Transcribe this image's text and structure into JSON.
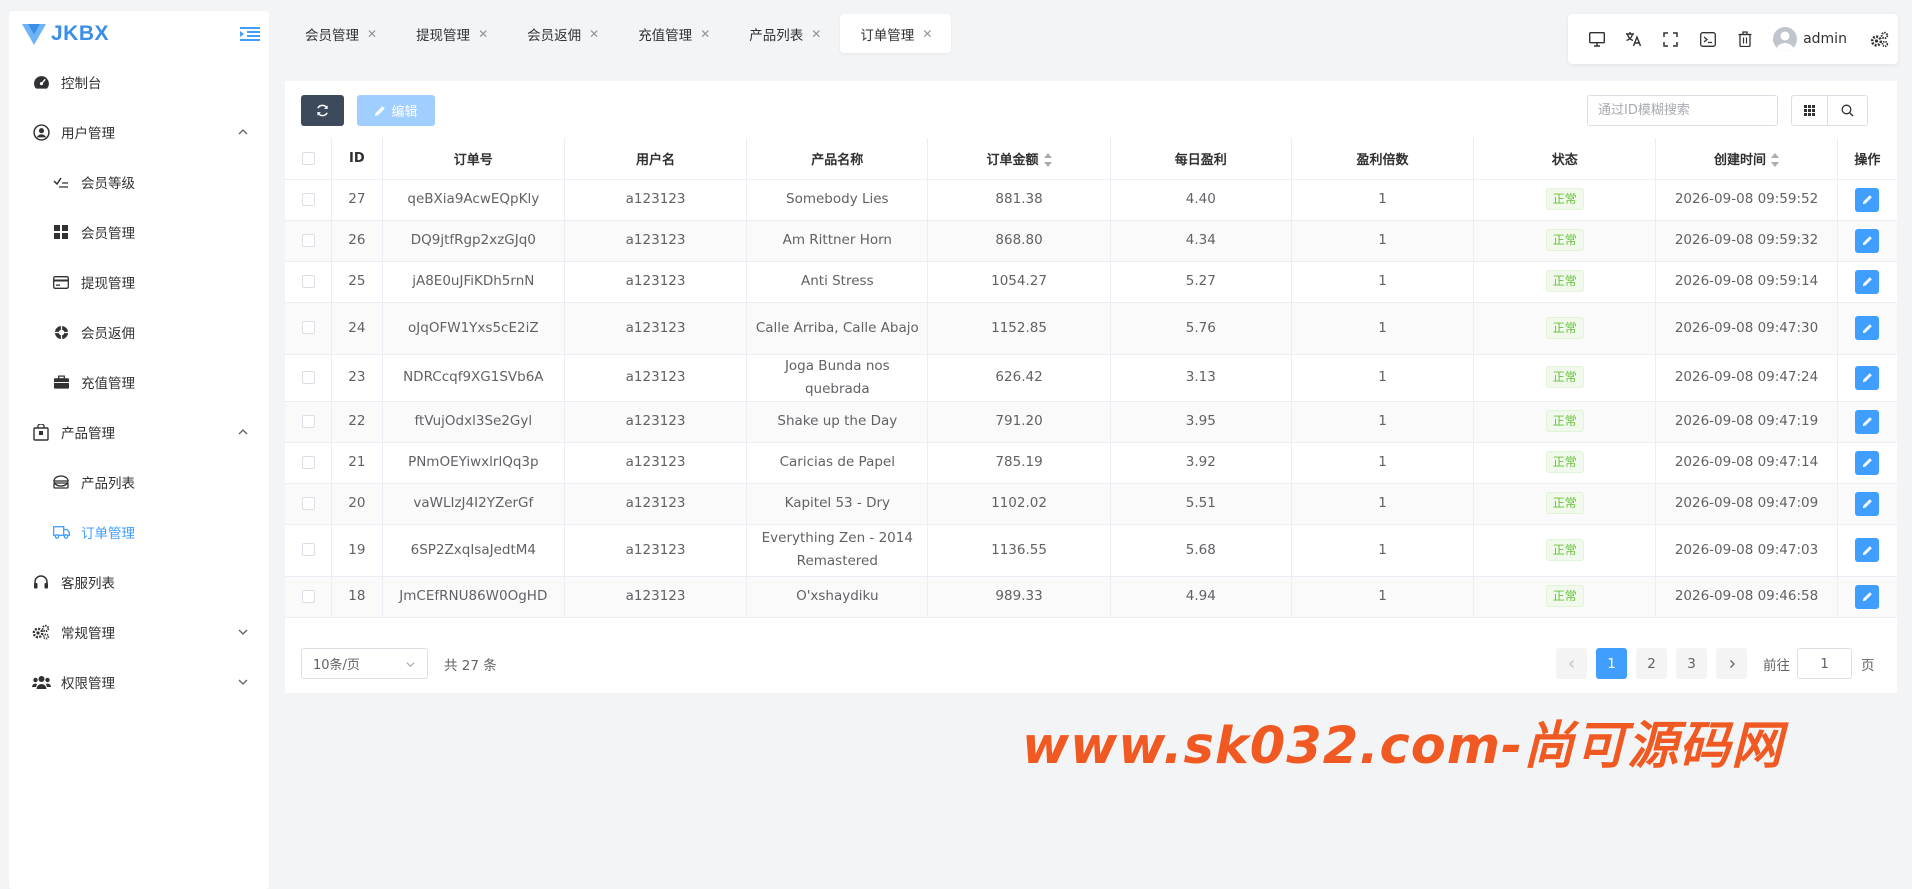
{
  "brand": {
    "name": "JKBX",
    "color": "#3a8ee6"
  },
  "sidebar": {
    "items": [
      {
        "label": "控制台",
        "icon": "dashboard-icon"
      },
      {
        "label": "用户管理",
        "icon": "user-circle-icon",
        "expanded": true,
        "children": [
          {
            "label": "会员等级",
            "icon": "level-icon"
          },
          {
            "label": "会员管理",
            "icon": "grid-icon"
          },
          {
            "label": "提现管理",
            "icon": "card-icon"
          },
          {
            "label": "会员返佣",
            "icon": "commission-icon"
          },
          {
            "label": "充值管理",
            "icon": "briefcase-icon"
          }
        ]
      },
      {
        "label": "产品管理",
        "icon": "product-icon",
        "expanded": true,
        "children": [
          {
            "label": "产品列表",
            "icon": "list-icon"
          },
          {
            "label": "订单管理",
            "icon": "truck-icon",
            "active": true
          }
        ]
      },
      {
        "label": "客服列表",
        "icon": "headset-icon"
      },
      {
        "label": "常规管理",
        "icon": "gears-icon",
        "expanded": false
      },
      {
        "label": "权限管理",
        "icon": "users-icon",
        "expanded": false
      }
    ]
  },
  "tabs": [
    {
      "label": "会员管理"
    },
    {
      "label": "提现管理"
    },
    {
      "label": "会员返佣"
    },
    {
      "label": "充值管理"
    },
    {
      "label": "产品列表"
    },
    {
      "label": "订单管理",
      "active": true
    }
  ],
  "toolbar": {
    "icons": [
      "monitor-icon",
      "translate-icon",
      "fullscreen-icon",
      "terminal-icon",
      "trash-icon"
    ],
    "user_name": "admin"
  },
  "actions": {
    "edit_label": "编辑",
    "search_placeholder": "通过ID模糊搜索"
  },
  "table": {
    "columns": [
      "ID",
      "订单号",
      "用户名",
      "产品名称",
      "订单金额",
      "每日盈利",
      "盈利倍数",
      "状态",
      "创建时间",
      "操作"
    ],
    "sortable": [
      "订单金额",
      "创建时间"
    ],
    "rows": [
      {
        "id": "27",
        "order_no": "qeBXia9AcwEQpKly",
        "user": "a123123",
        "product": "Somebody Lies",
        "amount": "881.38",
        "daily": "4.40",
        "multiple": "1",
        "status": "正常",
        "created": "2026-09-08 09:59:52"
      },
      {
        "id": "26",
        "order_no": "DQ9jtfRgp2xzGJq0",
        "user": "a123123",
        "product": "Am Rittner Horn",
        "amount": "868.80",
        "daily": "4.34",
        "multiple": "1",
        "status": "正常",
        "created": "2026-09-08 09:59:32"
      },
      {
        "id": "25",
        "order_no": "jA8E0uJFiKDh5rnN",
        "user": "a123123",
        "product": "Anti Stress",
        "amount": "1054.27",
        "daily": "5.27",
        "multiple": "1",
        "status": "正常",
        "created": "2026-09-08 09:59:14"
      },
      {
        "id": "24",
        "order_no": "oJqOFW1Yxs5cE2iZ",
        "user": "a123123",
        "product": "Calle Arriba, Calle Abajo",
        "amount": "1152.85",
        "daily": "5.76",
        "multiple": "1",
        "status": "正常",
        "created": "2026-09-08 09:47:30"
      },
      {
        "id": "23",
        "order_no": "NDRCcqf9XG1SVb6A",
        "user": "a123123",
        "product": "Joga Bunda nos quebrada",
        "amount": "626.42",
        "daily": "3.13",
        "multiple": "1",
        "status": "正常",
        "created": "2026-09-08 09:47:24"
      },
      {
        "id": "22",
        "order_no": "ftVujOdxl3Se2Gyl",
        "user": "a123123",
        "product": "Shake up the Day",
        "amount": "791.20",
        "daily": "3.95",
        "multiple": "1",
        "status": "正常",
        "created": "2026-09-08 09:47:19"
      },
      {
        "id": "21",
        "order_no": "PNmOEYiwxlrlQq3p",
        "user": "a123123",
        "product": "Caricias de Papel",
        "amount": "785.19",
        "daily": "3.92",
        "multiple": "1",
        "status": "正常",
        "created": "2026-09-08 09:47:14"
      },
      {
        "id": "20",
        "order_no": "vaWLIzJ4I2YZerGf",
        "user": "a123123",
        "product": "Kapitel 53 - Dry",
        "amount": "1102.02",
        "daily": "5.51",
        "multiple": "1",
        "status": "正常",
        "created": "2026-09-08 09:47:09"
      },
      {
        "id": "19",
        "order_no": "6SP2ZxqIsaJedtM4",
        "user": "a123123",
        "product": "Everything Zen - 2014 Remastered",
        "amount": "1136.55",
        "daily": "5.68",
        "multiple": "1",
        "status": "正常",
        "created": "2026-09-08 09:47:03"
      },
      {
        "id": "18",
        "order_no": "JmCEfRNU86W0OgHD",
        "user": "a123123",
        "product": "O'xshaydiku",
        "amount": "989.33",
        "daily": "4.94",
        "multiple": "1",
        "status": "正常",
        "created": "2026-09-08 09:46:58"
      }
    ]
  },
  "pagination": {
    "page_size": "10条/页",
    "total": "共 27 条",
    "pages": [
      "1",
      "2",
      "3"
    ],
    "current": "1",
    "goto_label": "前往",
    "goto_value": "1",
    "page_suffix": "页"
  },
  "watermark": "www.sk032.com-尚可源码网",
  "colors": {
    "primary": "#409eff",
    "dark_button": "#3d4a5c",
    "success": "#67c23a",
    "watermark": "#f05a22"
  }
}
